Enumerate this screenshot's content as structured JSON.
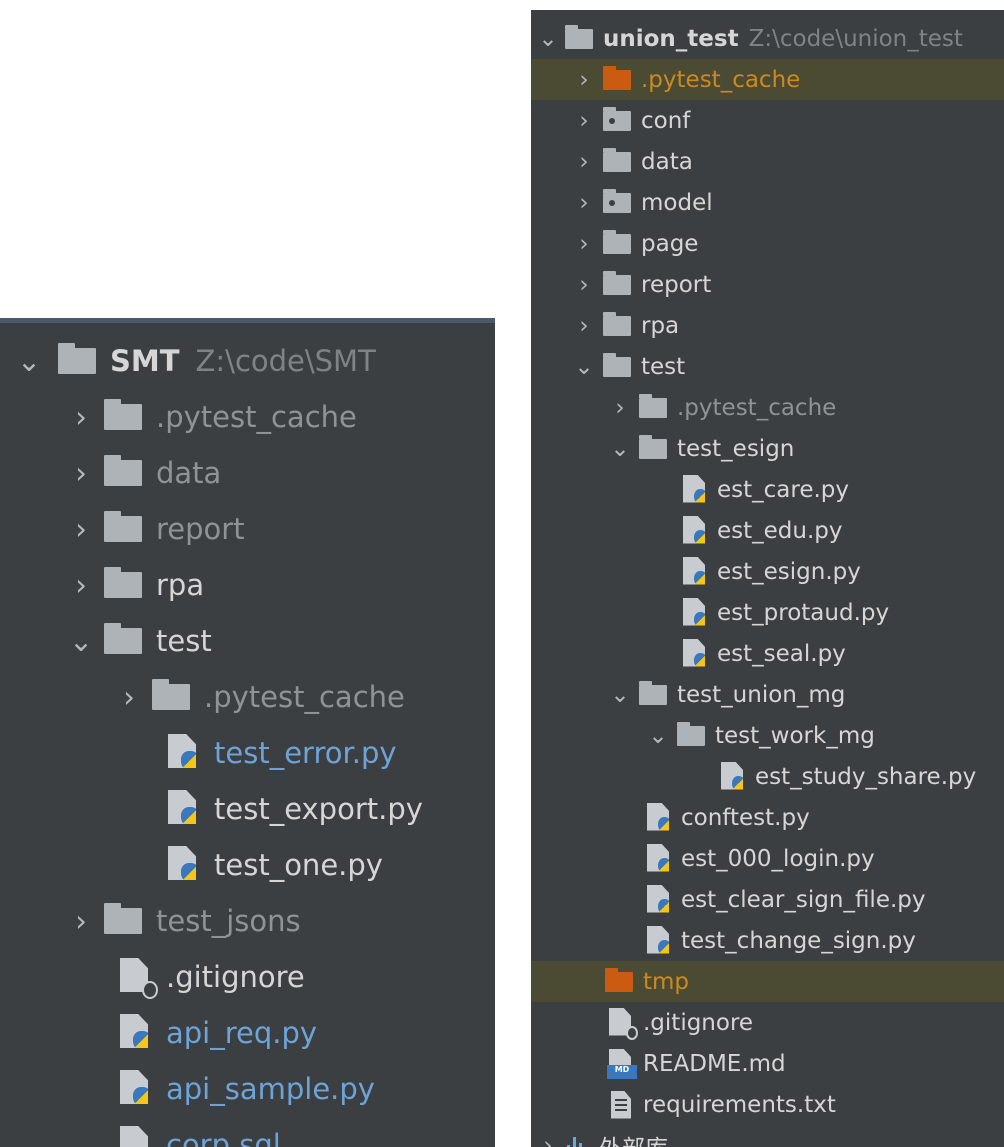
{
  "left_tree": {
    "root": {
      "name": "SMT",
      "path": "Z:\\code\\SMT"
    },
    "items": [
      {
        "label": ".pytest_cache",
        "kind": "folder",
        "state": "collapsed",
        "style": "grey"
      },
      {
        "label": "data",
        "kind": "folder",
        "state": "collapsed",
        "style": "grey"
      },
      {
        "label": "report",
        "kind": "folder",
        "state": "collapsed",
        "style": "grey"
      },
      {
        "label": "rpa",
        "kind": "folder",
        "state": "collapsed",
        "style": "normal"
      },
      {
        "label": "test",
        "kind": "folder",
        "state": "expanded",
        "style": "normal"
      },
      {
        "label": ".pytest_cache",
        "kind": "folder",
        "state": "collapsed",
        "style": "grey"
      },
      {
        "label": "test_error.py",
        "kind": "python-file",
        "style": "blue"
      },
      {
        "label": "test_export.py",
        "kind": "python-file",
        "style": "normal"
      },
      {
        "label": "test_one.py",
        "kind": "python-file",
        "style": "normal"
      },
      {
        "label": "test_jsons",
        "kind": "folder",
        "state": "collapsed",
        "style": "grey"
      },
      {
        "label": ".gitignore",
        "kind": "gitignore-file",
        "style": "normal"
      },
      {
        "label": "api_req.py",
        "kind": "python-file",
        "style": "blue"
      },
      {
        "label": "api_sample.py",
        "kind": "python-file",
        "style": "blue"
      },
      {
        "label": "corp.sql",
        "kind": "sql-file",
        "style": "blue"
      }
    ]
  },
  "right_tree": {
    "root": {
      "name": "union_test",
      "path": "Z:\\code\\union_test"
    },
    "items": [
      {
        "label": ".pytest_cache",
        "kind": "folder",
        "state": "collapsed",
        "style": "excluded"
      },
      {
        "label": "conf",
        "kind": "package-folder",
        "state": "collapsed",
        "style": "normal"
      },
      {
        "label": "data",
        "kind": "folder",
        "state": "collapsed",
        "style": "normal"
      },
      {
        "label": "model",
        "kind": "package-folder",
        "state": "collapsed",
        "style": "normal"
      },
      {
        "label": "page",
        "kind": "folder",
        "state": "collapsed",
        "style": "normal"
      },
      {
        "label": "report",
        "kind": "folder",
        "state": "collapsed",
        "style": "normal"
      },
      {
        "label": "rpa",
        "kind": "folder",
        "state": "collapsed",
        "style": "normal"
      },
      {
        "label": "test",
        "kind": "folder",
        "state": "expanded",
        "style": "normal"
      },
      {
        "label": ".pytest_cache",
        "kind": "folder",
        "state": "collapsed",
        "style": "grey"
      },
      {
        "label": "test_esign",
        "kind": "folder",
        "state": "expanded",
        "style": "normal"
      },
      {
        "label": "est_care.py",
        "kind": "python-file",
        "style": "normal"
      },
      {
        "label": "est_edu.py",
        "kind": "python-file",
        "style": "normal"
      },
      {
        "label": "est_esign.py",
        "kind": "python-file",
        "style": "normal"
      },
      {
        "label": "est_protaud.py",
        "kind": "python-file",
        "style": "normal"
      },
      {
        "label": "est_seal.py",
        "kind": "python-file",
        "style": "normal"
      },
      {
        "label": "test_union_mg",
        "kind": "folder",
        "state": "expanded",
        "style": "normal"
      },
      {
        "label": "test_work_mg",
        "kind": "folder",
        "state": "expanded",
        "style": "normal"
      },
      {
        "label": "est_study_share.py",
        "kind": "python-file",
        "style": "normal"
      },
      {
        "label": "conftest.py",
        "kind": "python-file",
        "style": "normal"
      },
      {
        "label": "est_000_login.py",
        "kind": "python-file",
        "style": "normal"
      },
      {
        "label": "est_clear_sign_file.py",
        "kind": "python-file",
        "style": "normal"
      },
      {
        "label": "test_change_sign.py",
        "kind": "python-file",
        "style": "normal"
      },
      {
        "label": "tmp",
        "kind": "folder",
        "state": "none",
        "style": "excluded"
      },
      {
        "label": ".gitignore",
        "kind": "gitignore-file",
        "style": "normal"
      },
      {
        "label": "README.md",
        "kind": "markdown-file",
        "style": "normal"
      },
      {
        "label": "requirements.txt",
        "kind": "text-file",
        "style": "normal"
      },
      {
        "label": "外部库",
        "kind": "external-libraries",
        "state": "collapsed",
        "style": "normal"
      }
    ]
  },
  "icons": {
    "arrow_collapsed": "chevron-right-icon",
    "arrow_expanded": "chevron-down-icon",
    "folder": "folder-icon",
    "package_folder": "package-folder-icon",
    "python_file": "python-file-icon",
    "gitignore_file": "gitignore-file-icon",
    "markdown_file": "markdown-file-icon",
    "text_file": "text-file-icon",
    "external_libraries": "libraries-icon"
  },
  "colors": {
    "panel_bg": "#3c3f41",
    "text": "#d6d6d6",
    "excluded_text": "#cc8a1e",
    "grey_text": "#8e9397",
    "blue_text": "#6ea3d8",
    "highlight_row": "#4b4a33",
    "excluded_folder": "#cc5b12"
  }
}
